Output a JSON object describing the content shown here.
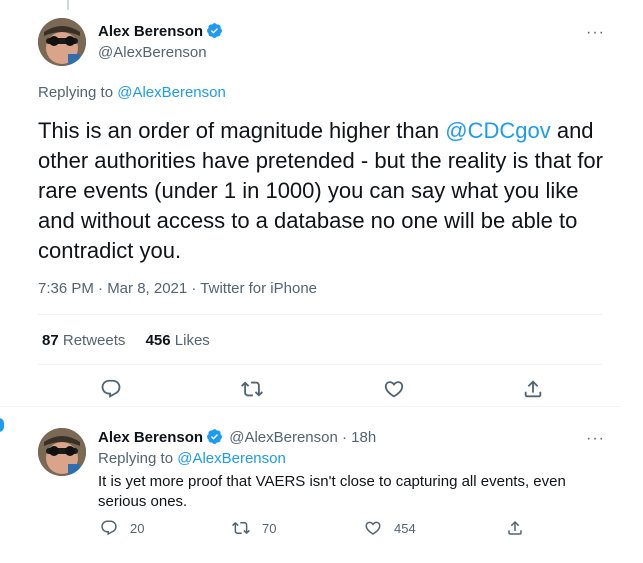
{
  "main_tweet": {
    "author_name": "Alex Berenson",
    "author_handle": "@AlexBerenson",
    "replying_to_label": "Replying to",
    "replying_to_handle": "@AlexBerenson",
    "text_before_mention": "This is an order of magnitude higher than ",
    "mention": "@CDCgov",
    "text_after_mention": " and other authorities have pretended - but the reality is that for rare events (under 1 in 1000) you can say what you like and without access to a database no one will be able to contradict you.",
    "timestamp": "7:36 PM · Mar 8, 2021 · Twitter for iPhone",
    "retweets_count": "87",
    "retweets_label": "Retweets",
    "likes_count": "456",
    "likes_label": "Likes",
    "more_icon": "···"
  },
  "reply_tweet": {
    "author_name": "Alex Berenson",
    "author_handle": "@AlexBerenson",
    "age": "· 18h",
    "replying_to_label": "Replying to",
    "replying_to_handle": "@AlexBerenson",
    "text": "It is yet more proof that VAERS isn't close to capturing all events, even serious ones.",
    "reply_count": "20",
    "retweet_count": "70",
    "like_count": "454",
    "more_icon": "···"
  },
  "colors": {
    "accent": "#1d9bf0",
    "secondary_text": "#536471",
    "divider": "#eff3f4",
    "retweet_hover": "#00ba7c"
  },
  "icons": [
    "verified-badge-icon",
    "more-icon",
    "reply-icon",
    "retweet-icon",
    "like-icon",
    "share-icon"
  ]
}
